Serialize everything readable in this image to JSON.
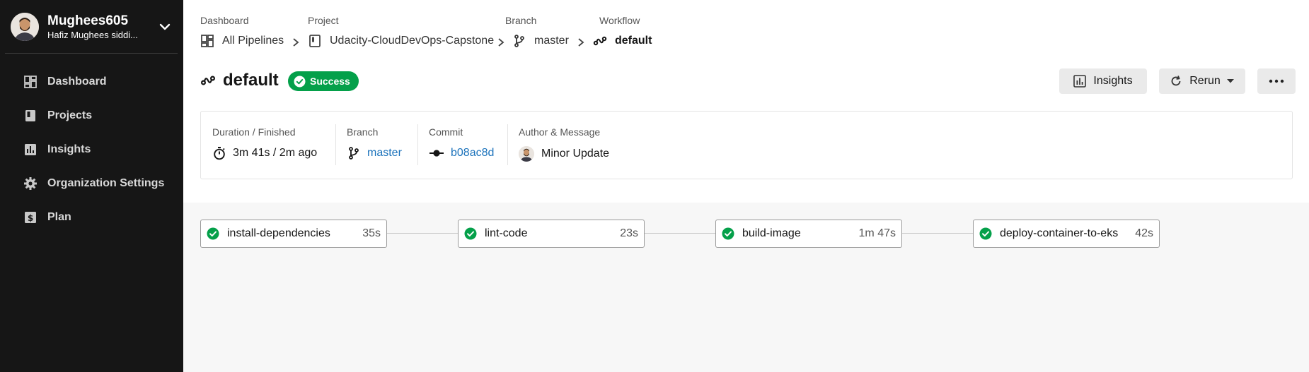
{
  "org": {
    "name": "Mughees605",
    "user": "Hafiz Mughees siddi..."
  },
  "nav": {
    "items": [
      {
        "label": "Dashboard",
        "icon": "dashboard-icon"
      },
      {
        "label": "Projects",
        "icon": "projects-icon"
      },
      {
        "label": "Insights",
        "icon": "insights-icon"
      },
      {
        "label": "Organization Settings",
        "icon": "gear-icon"
      },
      {
        "label": "Plan",
        "icon": "dollar-icon"
      }
    ]
  },
  "breadcrumbs": [
    {
      "title": "Dashboard",
      "value": "All Pipelines",
      "icon": "dashboard-icon"
    },
    {
      "title": "Project",
      "value": "Udacity-CloudDevOps-Capstone",
      "icon": "project-icon"
    },
    {
      "title": "Branch",
      "value": "master",
      "icon": "branch-icon"
    },
    {
      "title": "Workflow",
      "value": "default",
      "icon": "workflow-icon"
    }
  ],
  "workflow": {
    "name": "default",
    "status": "Success",
    "status_color": "#04a04a"
  },
  "actions": {
    "insights_label": "Insights",
    "rerun_label": "Rerun"
  },
  "meta": {
    "duration_title": "Duration / Finished",
    "duration_value": "3m 41s / 2m ago",
    "branch_title": "Branch",
    "branch_value": "master",
    "commit_title": "Commit",
    "commit_value": "b08ac8d",
    "author_title": "Author & Message",
    "author_message": "Minor Update",
    "link_color": "#1b72bb"
  },
  "jobs": [
    {
      "name": "install-dependencies",
      "duration": "35s",
      "status": "success"
    },
    {
      "name": "lint-code",
      "duration": "23s",
      "status": "success"
    },
    {
      "name": "build-image",
      "duration": "1m 47s",
      "status": "success"
    },
    {
      "name": "deploy-container-to-eks",
      "duration": "42s",
      "status": "success"
    }
  ]
}
